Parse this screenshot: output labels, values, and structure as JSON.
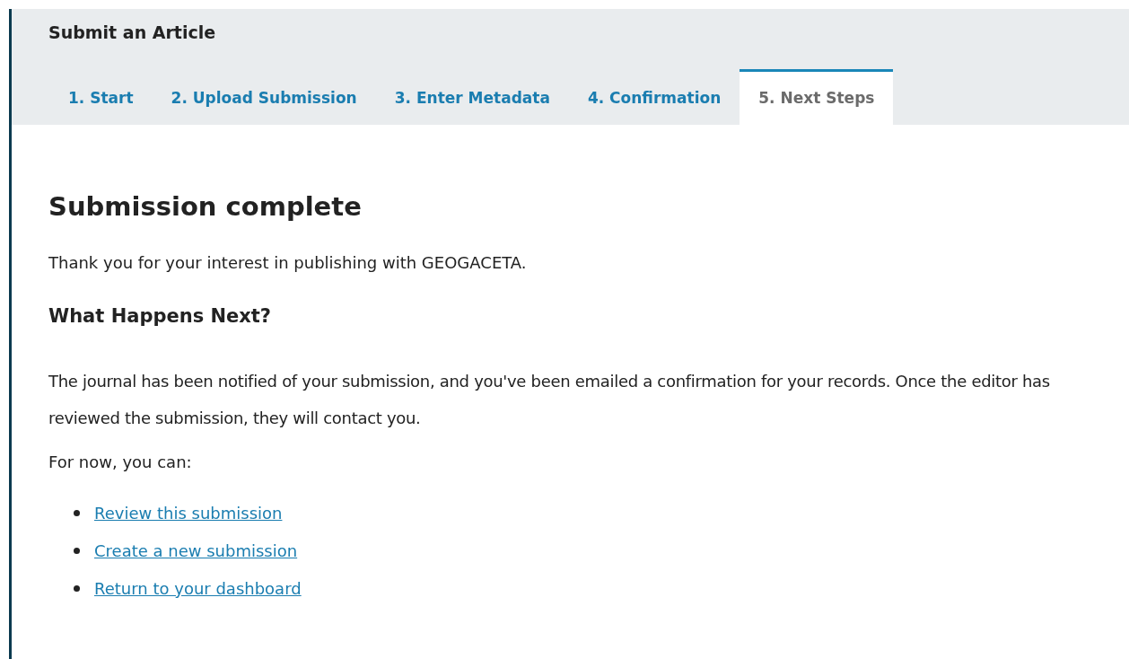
{
  "header": {
    "title": "Submit an Article"
  },
  "tabs": [
    {
      "label": "1. Start",
      "selected": false
    },
    {
      "label": "2. Upload Submission",
      "selected": false
    },
    {
      "label": "3. Enter Metadata",
      "selected": false
    },
    {
      "label": "4. Confirmation",
      "selected": false
    },
    {
      "label": "5. Next Steps",
      "selected": true
    }
  ],
  "content": {
    "heading": "Submission complete",
    "intro": "Thank you for your interest in publishing with GEOGACETA.",
    "subheading": "What Happens Next?",
    "paragraph": "The journal has been notified of your submission, and you've been emailed a confirmation for your records. Once the editor has reviewed the submission, they will contact you.",
    "prompt": "For now, you can:",
    "links": [
      "Review this submission",
      "Create a new submission",
      "Return to your dashboard"
    ]
  }
}
